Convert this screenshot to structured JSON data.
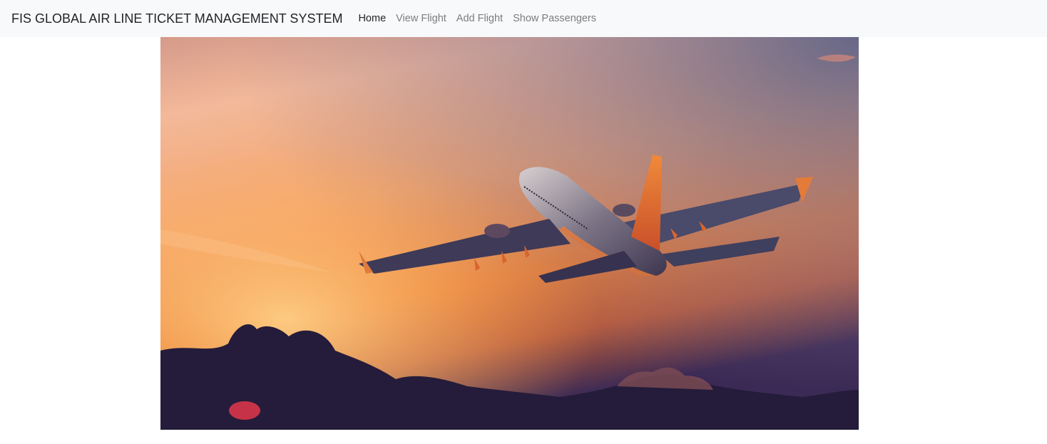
{
  "navbar": {
    "brand": "FIS GLOBAL AIR LINE TICKET MANAGEMENT SYSTEM",
    "links": [
      {
        "label": "Home",
        "active": true
      },
      {
        "label": "View Flight",
        "active": false
      },
      {
        "label": "Add Flight",
        "active": false
      },
      {
        "label": "Show Passengers",
        "active": false
      }
    ]
  },
  "hero": {
    "image": "airplane-sunset-photo"
  },
  "colors": {
    "navbar_bg": "#f8f9fa",
    "link_active": "#212529",
    "link_inactive": "#7a7d80",
    "sky_top": "#6e6a8c",
    "sky_glow": "#f6b27a",
    "horizon": "#e8782e",
    "clouds": "#241c3a"
  }
}
